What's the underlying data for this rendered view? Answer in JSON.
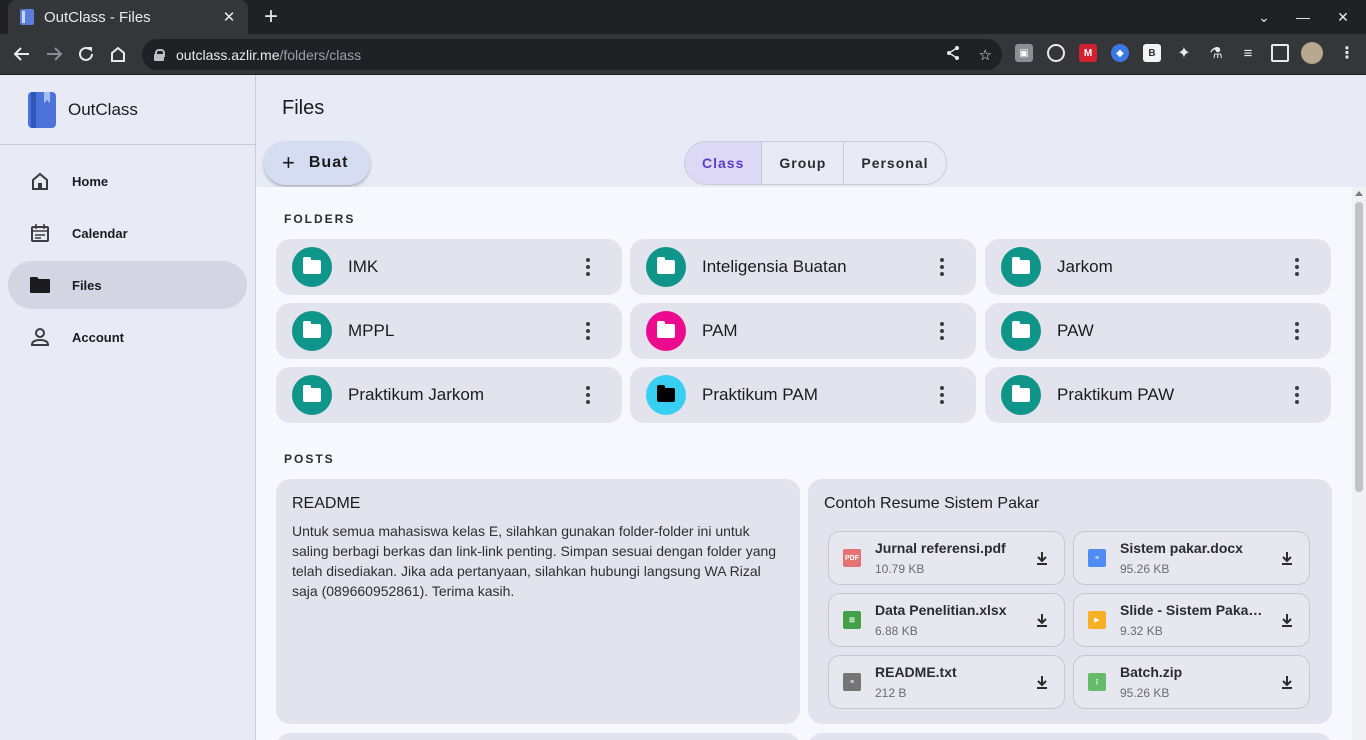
{
  "browser": {
    "tab_title": "OutClass - Files",
    "url_host": "outclass.azlir.me",
    "url_path": "/folders/class"
  },
  "sidebar": {
    "brand": "OutClass",
    "items": [
      {
        "label": "Home",
        "icon": "home-icon",
        "active": false
      },
      {
        "label": "Calendar",
        "icon": "calendar-icon",
        "active": false
      },
      {
        "label": "Files",
        "icon": "folder-icon",
        "active": true
      },
      {
        "label": "Account",
        "icon": "person-icon",
        "active": false
      }
    ]
  },
  "main": {
    "title": "Files",
    "create_label": "Buat",
    "tabs": [
      {
        "label": "Class",
        "active": true
      },
      {
        "label": "Group",
        "active": false
      },
      {
        "label": "Personal",
        "active": false
      }
    ],
    "folders_heading": "FOLDERS",
    "folders": [
      {
        "name": "IMK",
        "color": "#0f958a",
        "icon_color": "#ffffff"
      },
      {
        "name": "Inteligensia Buatan",
        "color": "#0f958a",
        "icon_color": "#ffffff"
      },
      {
        "name": "Jarkom",
        "color": "#0f958a",
        "icon_color": "#ffffff"
      },
      {
        "name": "MPPL",
        "color": "#0f958a",
        "icon_color": "#ffffff"
      },
      {
        "name": "PAM",
        "color": "#ec0b8e",
        "icon_color": "#ffffff"
      },
      {
        "name": "PAW",
        "color": "#0f958a",
        "icon_color": "#ffffff"
      },
      {
        "name": "Praktikum Jarkom",
        "color": "#0f958a",
        "icon_color": "#ffffff"
      },
      {
        "name": "Praktikum PAM",
        "color": "#38d0f2",
        "icon_color": "#000000"
      },
      {
        "name": "Praktikum PAW",
        "color": "#0f958a",
        "icon_color": "#ffffff"
      }
    ],
    "posts_heading": "POSTS",
    "posts": [
      {
        "title": "README",
        "body": "Untuk semua mahasiswa kelas E, silahkan gunakan folder-folder ini untuk saling berbagi berkas dan link-link penting. Simpan sesuai dengan folder yang telah disediakan. Jika ada pertanyaan, silahkan hubungi langsung WA Rizal saja (089660952861). Terima kasih."
      },
      {
        "title": "Contoh Resume Sistem Pakar",
        "files": [
          {
            "name": "Jurnal referensi.pdf",
            "size": "10.79 KB",
            "icon": "pdf-icon",
            "color": "#e57373",
            "glyph": "PDF"
          },
          {
            "name": "Sistem pakar.docx",
            "size": "95.26 KB",
            "icon": "doc-icon",
            "color": "#4f8df5",
            "glyph": "≡"
          },
          {
            "name": "Data Penelitian.xlsx",
            "size": "6.88 KB",
            "icon": "sheet-icon",
            "color": "#43a047",
            "glyph": "⊞"
          },
          {
            "name": "Slide - Sistem Pakar....",
            "size": "9.32 KB",
            "icon": "slides-icon",
            "color": "#f6b026",
            "glyph": "▶"
          },
          {
            "name": "README.txt",
            "size": "212 B",
            "icon": "text-file-icon",
            "color": "#757575",
            "glyph": "≡"
          },
          {
            "name": "Batch.zip",
            "size": "95.26 KB",
            "icon": "zip-icon",
            "color": "#66bb6a",
            "glyph": "⋮"
          }
        ]
      }
    ]
  }
}
